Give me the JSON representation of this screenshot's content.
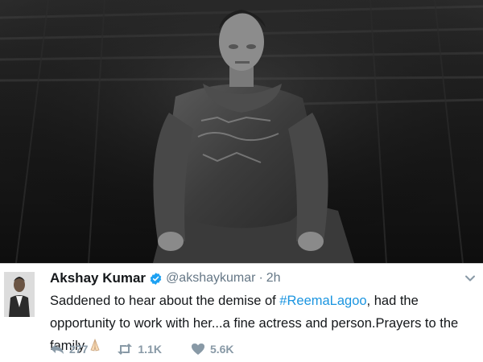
{
  "tweet": {
    "display_name": "Akshay Kumar",
    "handle": "@akshaykumar",
    "separator": "·",
    "time": "2h",
    "text_before": "Saddened to hear about the demise of ",
    "hashtag": "#ReemaLagoo",
    "text_after": ", had the opportunity to work with her...a fine actress and person.Prayers to the family",
    "emoji_icon": "folded-hands-icon",
    "verified_icon": "verified-badge-icon"
  },
  "actions": {
    "reply_count": "277",
    "retweet_count": "1.1K",
    "like_count": "5.6K"
  },
  "colors": {
    "link": "#1b95e0",
    "verified": "#1da1f2",
    "meta": "#657786"
  }
}
